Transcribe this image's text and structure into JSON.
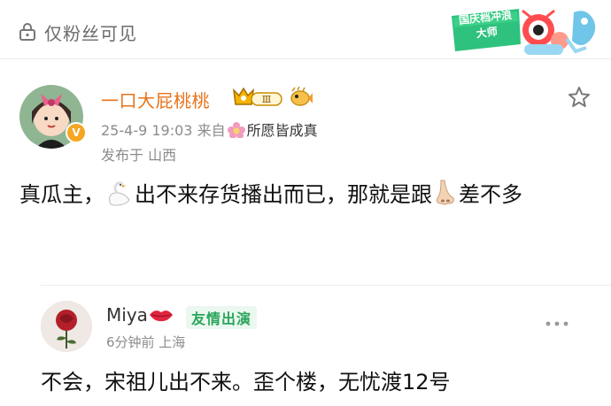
{
  "header": {
    "visibility_label": "仅粉丝可见",
    "promo": {
      "text": "国庆档冲浪大师",
      "icon": "promo-banner-icon"
    }
  },
  "post": {
    "username": "一口大屁桃桃",
    "level_badge": "Ⅲ",
    "verified_badge": "V",
    "meta": {
      "time": "25-4-9 19:03",
      "from_label": "来自",
      "source": "所愿皆成真"
    },
    "location": "发布于 山西",
    "body": {
      "part1": "真瓜主，",
      "part2": "出不来存货播出而已，那就是跟",
      "part3": "差不多"
    },
    "icons": [
      "swan-emoji",
      "nose-emoji",
      "flower-icon",
      "fish-icon",
      "star-icon"
    ]
  },
  "reply": {
    "username": "Miya",
    "tag": "友情出演",
    "meta": "6分钟前 上海",
    "body": "不会，宋祖儿出不来。歪个楼，无忧渡12号",
    "icons": [
      "lips-icon",
      "more-dots-icon"
    ]
  },
  "colors": {
    "username": "#e8731a",
    "meta_gray": "#8c8c8c",
    "friend_tag_text": "#2ba55b",
    "friend_tag_bg": "#eaf8ef"
  }
}
